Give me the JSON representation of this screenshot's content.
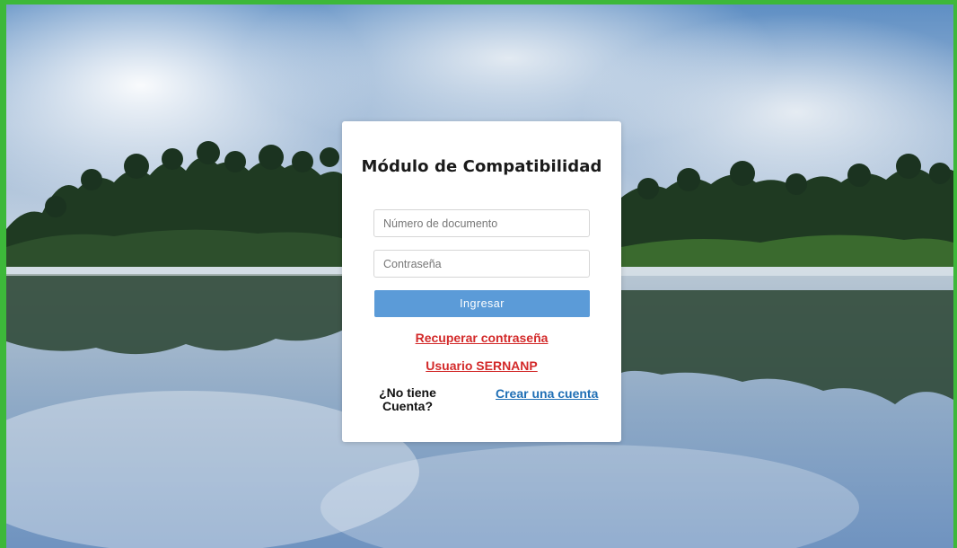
{
  "login": {
    "title": "Módulo de Compatibilidad",
    "document_placeholder": "Número de documento",
    "password_placeholder": "Contraseña",
    "submit_label": "Ingresar",
    "recover_link": "Recuperar contraseña",
    "sernanp_link": "Usuario SERNANP",
    "no_account_text": "¿No tiene Cuenta?",
    "create_account_link": "Crear una cuenta"
  },
  "colors": {
    "frame_border": "#3db83a",
    "button": "#5b9bd8",
    "red_link": "#d32a2a",
    "blue_link": "#1f6fb5"
  }
}
